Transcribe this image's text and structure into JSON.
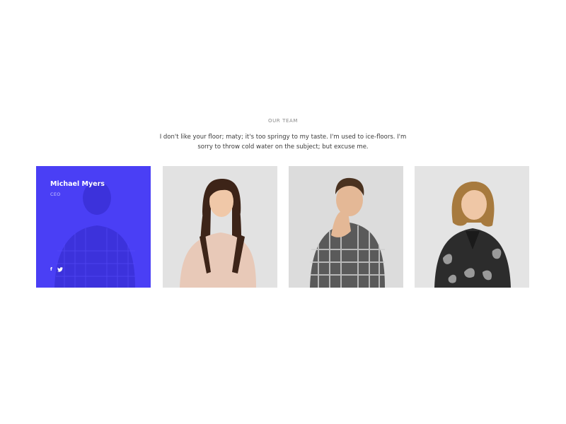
{
  "section": {
    "eyebrow": "OUR TEAM",
    "intro": "I don't like your floor; maty; it's too springy to my taste. I'm used to ice-floors. I'm sorry to throw cold water on the subject; but excuse me."
  },
  "team": [
    {
      "name": "Michael Myers",
      "role": "CEO",
      "highlighted": true,
      "socials": [
        {
          "icon": "facebook-icon",
          "glyph": "f"
        },
        {
          "icon": "twitter-icon",
          "glyph": "t"
        }
      ]
    },
    {
      "highlighted": false
    },
    {
      "highlighted": false
    },
    {
      "highlighted": false
    }
  ],
  "colors": {
    "accent": "#4a3ff5",
    "photo_background": "#e4e4e4"
  }
}
